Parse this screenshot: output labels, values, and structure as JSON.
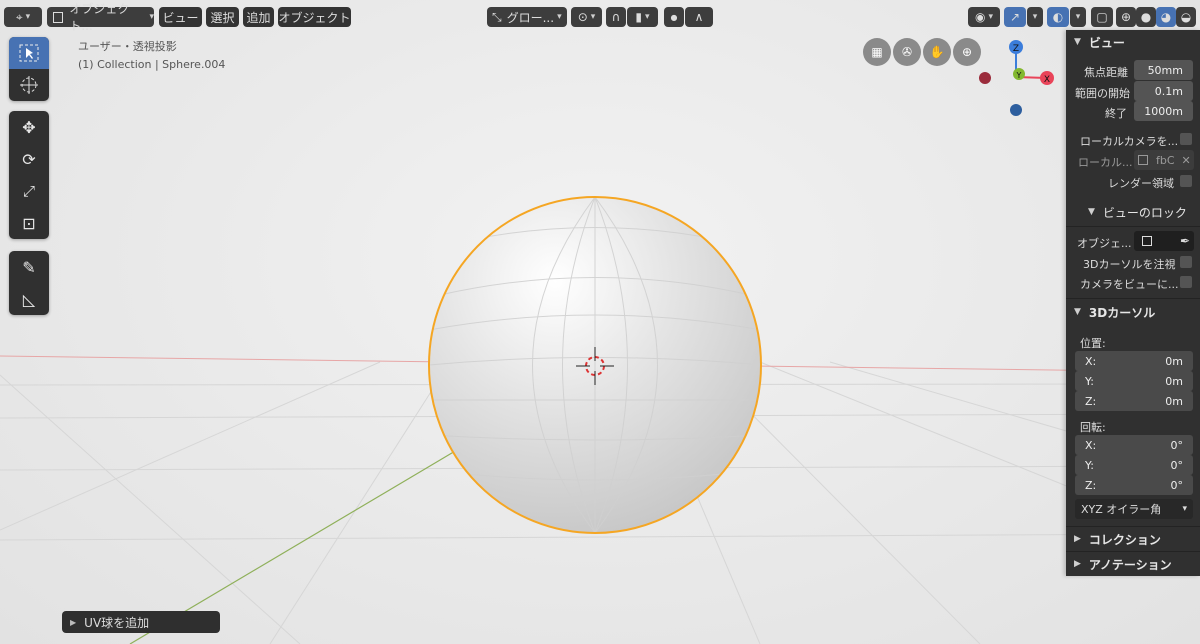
{
  "header": {
    "mode_label": "オブジェクト...",
    "menu": [
      "ビュー",
      "選択",
      "追加",
      "オブジェクト"
    ],
    "orientation_label": "グロー..."
  },
  "overlay": {
    "view_name": "ユーザー・透視投影",
    "object_info": "(1) Collection | Sphere.004"
  },
  "gizmo": {
    "z": "Z",
    "y": "Y",
    "x": "X"
  },
  "npanel": {
    "view_section": {
      "title": "ビュー",
      "focal_label": "焦点距離",
      "focal_value": "50mm",
      "clip_start_label": "範囲の開始",
      "clip_start_value": "0.1m",
      "clip_end_label": "終了",
      "clip_end_value": "1000m",
      "local_camera_label": "ローカルカメラを...",
      "local_label": "ローカル...",
      "local_value": "fbC",
      "render_region_label": "レンダー領域"
    },
    "view_lock": {
      "title": "ビューのロック",
      "object_label": "オブジェ...",
      "lock_cursor_label": "3Dカーソルを注視",
      "camera_to_view_label": "カメラをビューに..."
    },
    "cursor": {
      "title": "3Dカーソル",
      "location_label": "位置:",
      "loc": [
        {
          "axis": "X:",
          "value": "0m"
        },
        {
          "axis": "Y:",
          "value": "0m"
        },
        {
          "axis": "Z:",
          "value": "0m"
        }
      ],
      "rotation_label": "回転:",
      "rot": [
        {
          "axis": "X:",
          "value": "0°"
        },
        {
          "axis": "Y:",
          "value": "0°"
        },
        {
          "axis": "Z:",
          "value": "0°"
        }
      ],
      "rotation_mode": "XYZ オイラー角"
    },
    "collection_title": "コレクション",
    "annotation_title": "アノテーション"
  },
  "last_operator": "UV球を追加",
  "colors": {
    "accent": "#4772b3",
    "selection_outline": "#f5a623",
    "x_axis": "#e94459",
    "y_axis": "#83b82f",
    "z_axis": "#3b7ddb"
  }
}
